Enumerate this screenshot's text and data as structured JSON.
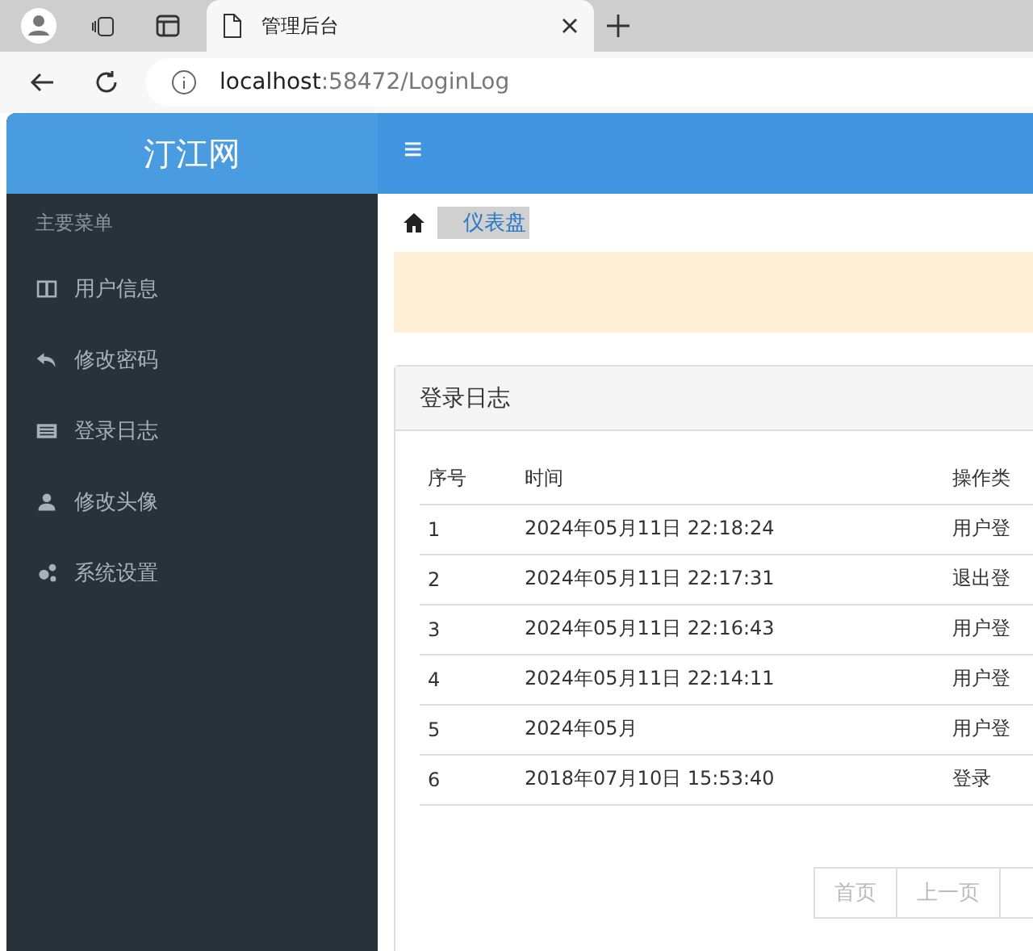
{
  "browser": {
    "tab_title": "管理后台",
    "url_host": "localhost",
    "url_rest": ":58472/LoginLog"
  },
  "brand": "汀江网",
  "menu_toggle": "≡",
  "sidebar": {
    "heading": "主要菜单",
    "items": [
      {
        "label": "用户信息",
        "kind": "columns"
      },
      {
        "label": "修改密码",
        "kind": "reply"
      },
      {
        "label": "登录日志",
        "kind": "list"
      },
      {
        "label": "修改头像",
        "kind": "user"
      },
      {
        "label": "系统设置",
        "kind": "gears"
      }
    ]
  },
  "breadcrumb": {
    "label": "仪表盘",
    "selected": true
  },
  "panel": {
    "title": "登录日志",
    "table": {
      "columns": [
        "序号",
        "时间",
        "操作类"
      ],
      "rows": [
        [
          "1",
          "2024年05月11日 22:18:24",
          "用户登"
        ],
        [
          "2",
          "2024年05月11日 22:17:31",
          "退出登"
        ],
        [
          "3",
          "2024年05月11日 22:16:43",
          "用户登"
        ],
        [
          "4",
          "2024年05月11日 22:14:11",
          "用户登"
        ],
        [
          "5",
          "2024年05月",
          "用户登"
        ],
        [
          "6",
          "2018年07月10日 15:53:40",
          "登录"
        ]
      ]
    },
    "pagination": [
      {
        "label": "首页",
        "disabled": true
      },
      {
        "label": "上一页",
        "disabled": true
      }
    ]
  }
}
